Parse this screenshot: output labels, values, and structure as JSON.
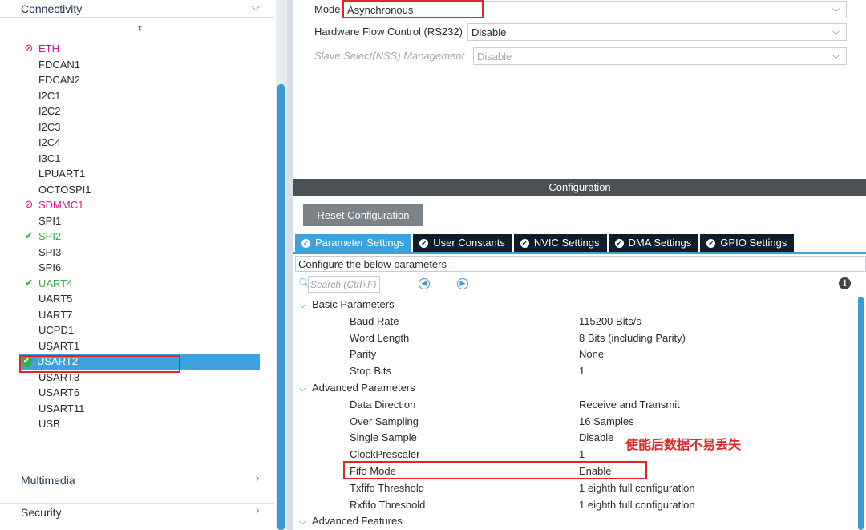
{
  "sidebar": {
    "categories": {
      "connectivity": "Connectivity",
      "multimedia": "Multimedia",
      "security": "Security"
    },
    "sort_icon": "sort-arrows-icon",
    "peripherals": [
      {
        "name": "ETH",
        "status": "disabled"
      },
      {
        "name": "FDCAN1",
        "status": "none"
      },
      {
        "name": "FDCAN2",
        "status": "none"
      },
      {
        "name": "I2C1",
        "status": "none"
      },
      {
        "name": "I2C2",
        "status": "none"
      },
      {
        "name": "I2C3",
        "status": "none"
      },
      {
        "name": "I2C4",
        "status": "none"
      },
      {
        "name": "I3C1",
        "status": "none"
      },
      {
        "name": "LPUART1",
        "status": "none"
      },
      {
        "name": "OCTOSPI1",
        "status": "none"
      },
      {
        "name": "SDMMC1",
        "status": "disabled"
      },
      {
        "name": "SPI1",
        "status": "none"
      },
      {
        "name": "SPI2",
        "status": "ok"
      },
      {
        "name": "SPI3",
        "status": "none"
      },
      {
        "name": "SPI6",
        "status": "none"
      },
      {
        "name": "UART4",
        "status": "ok"
      },
      {
        "name": "UART5",
        "status": "none"
      },
      {
        "name": "UART7",
        "status": "none"
      },
      {
        "name": "UCPD1",
        "status": "none"
      },
      {
        "name": "USART1",
        "status": "none"
      },
      {
        "name": "USART2",
        "status": "selected"
      },
      {
        "name": "USART3",
        "status": "none"
      },
      {
        "name": "USART6",
        "status": "none"
      },
      {
        "name": "USART11",
        "status": "none"
      },
      {
        "name": "USB",
        "status": "none"
      }
    ]
  },
  "mode": {
    "mode_label": "Mode",
    "mode_value": "Asynchronous",
    "flow_label": "Hardware Flow Control (RS232)",
    "flow_value": "Disable",
    "nss_label": "Slave Select(NSS) Management",
    "nss_value": "Disable"
  },
  "config": {
    "title": "Configuration",
    "reset_label": "Reset Configuration",
    "tabs": [
      {
        "label": "Parameter Settings",
        "active": true
      },
      {
        "label": "User Constants",
        "active": false
      },
      {
        "label": "NVIC Settings",
        "active": false
      },
      {
        "label": "DMA Settings",
        "active": false
      },
      {
        "label": "GPIO Settings",
        "active": false
      }
    ],
    "description": "Configure the below parameters :",
    "search_placeholder": "Search (Ctrl+F)",
    "groups": [
      {
        "label": "Basic Parameters",
        "rows": [
          {
            "name": "Baud Rate",
            "value": "115200 Bits/s"
          },
          {
            "name": "Word Length",
            "value": "8 Bits (including Parity)"
          },
          {
            "name": "Parity",
            "value": "None"
          },
          {
            "name": "Stop Bits",
            "value": "1"
          }
        ]
      },
      {
        "label": "Advanced Parameters",
        "rows": [
          {
            "name": "Data Direction",
            "value": "Receive and Transmit"
          },
          {
            "name": "Over Sampling",
            "value": "16 Samples"
          },
          {
            "name": "Single Sample",
            "value": "Disable"
          },
          {
            "name": "ClockPrescaler",
            "value": "1"
          },
          {
            "name": "Fifo Mode",
            "value": "Enable"
          },
          {
            "name": "Txfifo Threshold",
            "value": "1 eighth full configuration"
          },
          {
            "name": "Rxfifo Threshold",
            "value": "1 eighth full configuration"
          }
        ]
      },
      {
        "label": "Advanced Features",
        "rows": []
      }
    ]
  },
  "annotation": "使能后数据不易丢失",
  "colors": {
    "accent": "#3ea3dc",
    "highlight_box": "#e0262b",
    "disabled_periph": "#d4138d",
    "ok_periph": "#3aaa4a",
    "tab_dark": "#0e1c2c"
  }
}
